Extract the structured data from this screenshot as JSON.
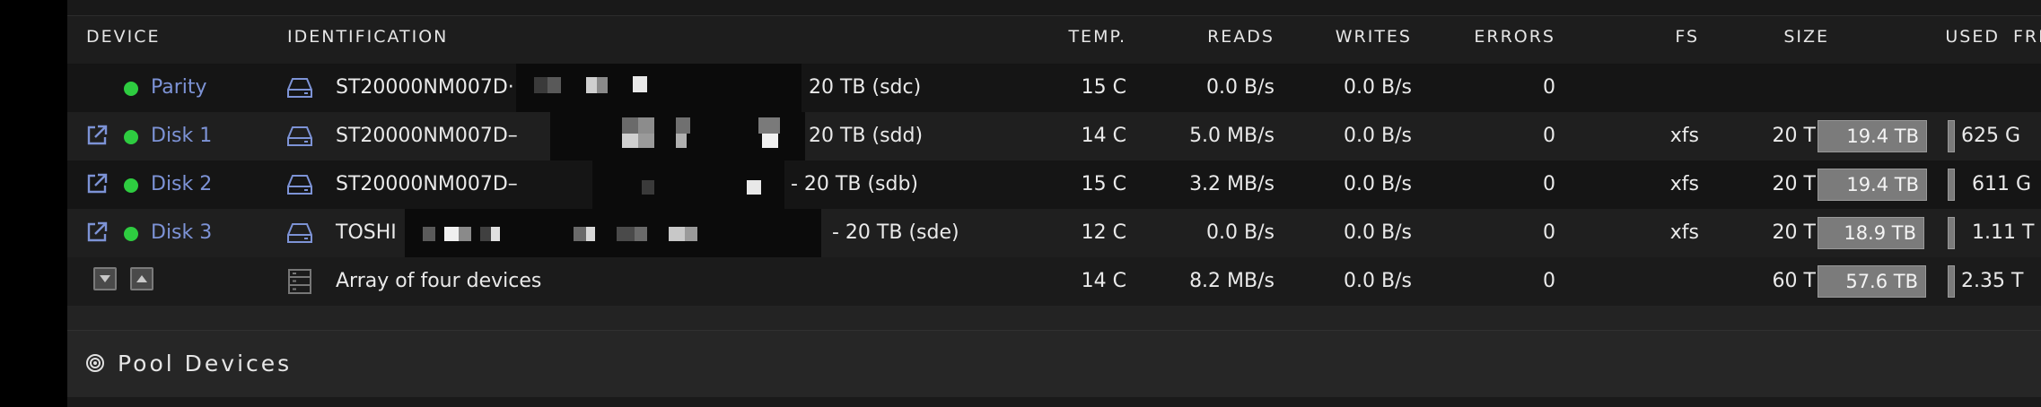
{
  "columns": {
    "device": "DEVICE",
    "identification": "IDENTIFICATION",
    "temp": "TEMP.",
    "reads": "READS",
    "writes": "WRITES",
    "errors": "ERRORS",
    "fs": "FS",
    "size": "SIZE",
    "used": "USED",
    "free": "FRE"
  },
  "rows": [
    {
      "name": "Parity",
      "id_prefix": "ST20000NM007D·",
      "id_suffix": "20 TB (sdc)",
      "temp": "15 C",
      "reads": "0.0 B/s",
      "writes": "0.0 B/s",
      "errors": "0",
      "fs": "",
      "size": "",
      "used": "",
      "used_pct": 0,
      "free": "",
      "status_color": "#2ecc40"
    },
    {
      "name": "Disk 1",
      "id_prefix": "ST20000NM007D–",
      "id_suffix": "20 TB (sdd)",
      "temp": "14 C",
      "reads": "5.0 MB/s",
      "writes": "0.0 B/s",
      "errors": "0",
      "fs": "xfs",
      "size": "20 TB",
      "used": "19.4 TB",
      "used_pct": 97,
      "free": "625 G",
      "status_color": "#2ecc40"
    },
    {
      "name": "Disk 2",
      "id_prefix": "ST20000NM007D–",
      "id_suffix": "- 20 TB (sdb)",
      "temp": "15 C",
      "reads": "3.2 MB/s",
      "writes": "0.0 B/s",
      "errors": "0",
      "fs": "xfs",
      "size": "20 TB",
      "used": "19.4 TB",
      "used_pct": 97,
      "free": "611 G",
      "status_color": "#2ecc40"
    },
    {
      "name": "Disk 3",
      "id_prefix": "TOSHI",
      "id_suffix": "- 20 TB (sde)",
      "temp": "12 C",
      "reads": "0.0 B/s",
      "writes": "0.0 B/s",
      "errors": "0",
      "fs": "xfs",
      "size": "20 TB",
      "used": "18.9 TB",
      "used_pct": 94.5,
      "free": "1.11 T",
      "status_color": "#2ecc40"
    }
  ],
  "total": {
    "label": "Array of four devices",
    "temp": "14 C",
    "reads": "8.2 MB/s",
    "writes": "0.0 B/s",
    "errors": "0",
    "size": "60 TB",
    "used": "57.6 TB",
    "used_pct": 96,
    "free": "2.35 T"
  },
  "pool": {
    "title": "Pool Devices"
  },
  "colors": {
    "link": "#7d93d6",
    "status_ok": "#2ecc40",
    "bar": "#7b7b7b"
  }
}
